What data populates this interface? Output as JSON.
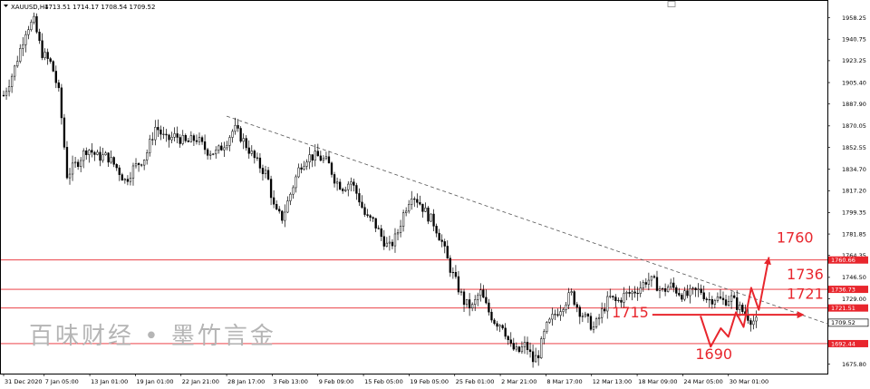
{
  "header": {
    "symbol": "XAUUSD,H4",
    "ohlc": "1713.51 1714.17 1708.54 1709.52"
  },
  "watermark": {
    "text": "百味财经 • 墨竹言金"
  },
  "colors": {
    "up": "#000000",
    "down": "#000000",
    "level": "#e8262d",
    "annotation": "#e8262d",
    "trend": "#555555"
  },
  "chart_data": {
    "type": "candlestick",
    "ylim": [
      1668,
      1972
    ],
    "yticks": [
      {
        "value": 1958.25,
        "label": "1958.25"
      },
      {
        "value": 1940.75,
        "label": "1940.75"
      },
      {
        "value": 1923.25,
        "label": "1923.25"
      },
      {
        "value": 1905.4,
        "label": "1905.40"
      },
      {
        "value": 1887.9,
        "label": "1887.90"
      },
      {
        "value": 1870.05,
        "label": "1870.05"
      },
      {
        "value": 1852.55,
        "label": "1852.55"
      },
      {
        "value": 1834.7,
        "label": "1834.70"
      },
      {
        "value": 1817.2,
        "label": "1817.20"
      },
      {
        "value": 1799.35,
        "label": "1799.35"
      },
      {
        "value": 1781.85,
        "label": "1781.85"
      },
      {
        "value": 1764.35,
        "label": "1764.35"
      },
      {
        "value": 1746.5,
        "label": "1746.50"
      },
      {
        "value": 1729.0,
        "label": "1729.00"
      },
      {
        "value": 1693.55,
        "label": "1693.55"
      },
      {
        "value": 1675.8,
        "label": "1675.80"
      }
    ],
    "xticks": [
      {
        "index": 0,
        "label": "31 Dec 2020"
      },
      {
        "index": 16,
        "label": "7 Jan 05:00"
      },
      {
        "index": 34,
        "label": "13 Jan 01:00"
      },
      {
        "index": 52,
        "label": "19 Jan 01:00"
      },
      {
        "index": 70,
        "label": "22 Jan 21:00"
      },
      {
        "index": 88,
        "label": "28 Jan 17:00"
      },
      {
        "index": 106,
        "label": "3 Feb 13:00"
      },
      {
        "index": 124,
        "label": "9 Feb 09:00"
      },
      {
        "index": 142,
        "label": "15 Feb 05:00"
      },
      {
        "index": 160,
        "label": "19 Feb 05:00"
      },
      {
        "index": 178,
        "label": "25 Feb 01:00"
      },
      {
        "index": 196,
        "label": "2 Mar 21:00"
      },
      {
        "index": 214,
        "label": "8 Mar 17:00"
      },
      {
        "index": 232,
        "label": "12 Mar 13:00"
      },
      {
        "index": 250,
        "label": "18 Mar 09:00"
      },
      {
        "index": 268,
        "label": "24 Mar 05:00"
      },
      {
        "index": 286,
        "label": "30 Mar 01:00"
      }
    ],
    "candle_count": 274,
    "price_path": [
      [
        0,
        1895
      ],
      [
        4,
        1915
      ],
      [
        9,
        1950
      ],
      [
        12,
        1955
      ],
      [
        15,
        1930
      ],
      [
        19,
        1920
      ],
      [
        22,
        1895
      ],
      [
        25,
        1830
      ],
      [
        29,
        1840
      ],
      [
        33,
        1852
      ],
      [
        37,
        1845
      ],
      [
        41,
        1845
      ],
      [
        45,
        1835
      ],
      [
        48,
        1825
      ],
      [
        51,
        1835
      ],
      [
        56,
        1845
      ],
      [
        60,
        1870
      ],
      [
        64,
        1858
      ],
      [
        68,
        1862
      ],
      [
        72,
        1856
      ],
      [
        76,
        1860
      ],
      [
        80,
        1850
      ],
      [
        84,
        1848
      ],
      [
        88,
        1858
      ],
      [
        91,
        1868
      ],
      [
        94,
        1860
      ],
      [
        97,
        1850
      ],
      [
        100,
        1840
      ],
      [
        104,
        1830
      ],
      [
        107,
        1800
      ],
      [
        110,
        1795
      ],
      [
        114,
        1820
      ],
      [
        117,
        1838
      ],
      [
        120,
        1845
      ],
      [
        124,
        1845
      ],
      [
        128,
        1840
      ],
      [
        131,
        1825
      ],
      [
        134,
        1820
      ],
      [
        137,
        1825
      ],
      [
        140,
        1812
      ],
      [
        143,
        1795
      ],
      [
        146,
        1792
      ],
      [
        149,
        1780
      ],
      [
        152,
        1770
      ],
      [
        155,
        1780
      ],
      [
        158,
        1800
      ],
      [
        161,
        1815
      ],
      [
        164,
        1808
      ],
      [
        167,
        1798
      ],
      [
        170,
        1790
      ],
      [
        173,
        1775
      ],
      [
        176,
        1755
      ],
      [
        179,
        1740
      ],
      [
        182,
        1725
      ],
      [
        185,
        1722
      ],
      [
        188,
        1735
      ],
      [
        191,
        1720
      ],
      [
        194,
        1710
      ],
      [
        197,
        1708
      ],
      [
        200,
        1690
      ],
      [
        203,
        1685
      ],
      [
        206,
        1692
      ],
      [
        209,
        1678
      ],
      [
        211,
        1684
      ],
      [
        214,
        1705
      ],
      [
        217,
        1715
      ],
      [
        221,
        1725
      ],
      [
        224,
        1733
      ],
      [
        227,
        1720
      ],
      [
        230,
        1712
      ],
      [
        233,
        1705
      ],
      [
        236,
        1718
      ],
      [
        239,
        1730
      ],
      [
        242,
        1726
      ],
      [
        245,
        1732
      ],
      [
        248,
        1734
      ],
      [
        251,
        1738
      ],
      [
        254,
        1745
      ],
      [
        257,
        1742
      ],
      [
        260,
        1735
      ],
      [
        263,
        1740
      ],
      [
        266,
        1735
      ],
      [
        269,
        1731
      ],
      [
        272,
        1734
      ],
      [
        275,
        1736
      ],
      [
        278,
        1728
      ],
      [
        281,
        1730
      ],
      [
        284,
        1727
      ],
      [
        287,
        1730
      ],
      [
        290,
        1722
      ],
      [
        293,
        1716
      ],
      [
        295,
        1712
      ],
      [
        297,
        1710
      ]
    ],
    "levels": [
      {
        "value": 1760.66,
        "label": "1760.66"
      },
      {
        "value": 1736.73,
        "label": "1736.73"
      },
      {
        "value": 1721.51,
        "label": "1721.51"
      },
      {
        "value": 1692.44,
        "label": "1692.44"
      }
    ],
    "current_price": {
      "value": 1709.52,
      "label": "1709.52"
    },
    "trendline": {
      "from": {
        "index": 88,
        "value": 1878
      },
      "to": {
        "index": 326,
        "value": 1708
      }
    },
    "annotations": [
      {
        "text": "1760",
        "index": 305,
        "value": 1775
      },
      {
        "text": "1736",
        "index": 309,
        "value": 1745
      },
      {
        "text": "1721",
        "index": 309,
        "value": 1729
      },
      {
        "text": "1715",
        "index": 240,
        "value": 1714
      },
      {
        "text": "1690",
        "index": 273,
        "value": 1680
      }
    ],
    "projection_arrow": {
      "from": {
        "index": 256,
        "value": 1716
      },
      "to": {
        "index": 316,
        "value": 1716
      }
    },
    "forecast_path": [
      [
        275,
        1715
      ],
      [
        279,
        1690
      ],
      [
        283,
        1705
      ],
      [
        286,
        1698
      ],
      [
        289,
        1718
      ],
      [
        292,
        1706
      ],
      [
        295,
        1738
      ],
      [
        298,
        1720
      ],
      [
        302,
        1763
      ]
    ]
  }
}
